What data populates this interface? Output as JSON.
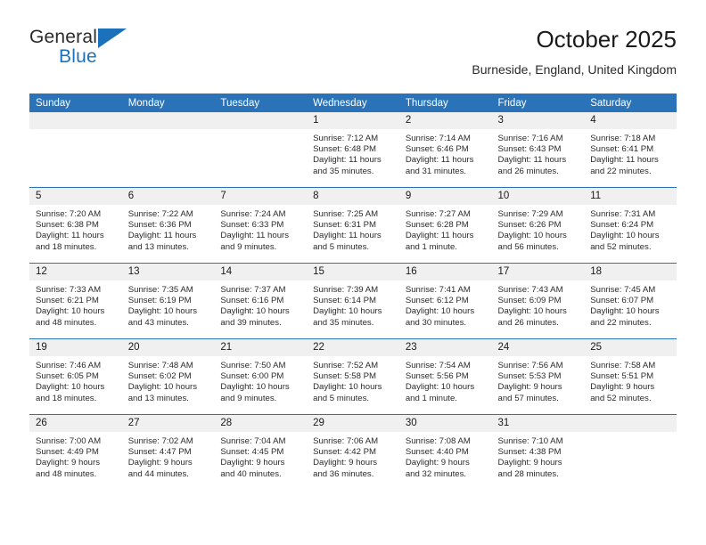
{
  "brand": {
    "name_top": "General",
    "name_bottom": "Blue",
    "accent_color": "#1c71bb"
  },
  "header": {
    "title": "October 2025",
    "subtitle": "Burneside, England, United Kingdom"
  },
  "theme": {
    "header_row_bg": "#2b73b8",
    "day_number_bg": "#f0f0f0",
    "text_color": "#2b2b2b"
  },
  "weekday_headers": [
    "Sunday",
    "Monday",
    "Tuesday",
    "Wednesday",
    "Thursday",
    "Friday",
    "Saturday"
  ],
  "weeks": [
    [
      {
        "day": "",
        "empty": true,
        "sunrise": "",
        "sunset": "",
        "daylight_line1": "",
        "daylight_line2": ""
      },
      {
        "day": "",
        "empty": true,
        "sunrise": "",
        "sunset": "",
        "daylight_line1": "",
        "daylight_line2": ""
      },
      {
        "day": "",
        "empty": true,
        "sunrise": "",
        "sunset": "",
        "daylight_line1": "",
        "daylight_line2": ""
      },
      {
        "day": "1",
        "sunrise": "Sunrise: 7:12 AM",
        "sunset": "Sunset: 6:48 PM",
        "daylight_line1": "Daylight: 11 hours",
        "daylight_line2": "and 35 minutes."
      },
      {
        "day": "2",
        "sunrise": "Sunrise: 7:14 AM",
        "sunset": "Sunset: 6:46 PM",
        "daylight_line1": "Daylight: 11 hours",
        "daylight_line2": "and 31 minutes."
      },
      {
        "day": "3",
        "sunrise": "Sunrise: 7:16 AM",
        "sunset": "Sunset: 6:43 PM",
        "daylight_line1": "Daylight: 11 hours",
        "daylight_line2": "and 26 minutes."
      },
      {
        "day": "4",
        "sunrise": "Sunrise: 7:18 AM",
        "sunset": "Sunset: 6:41 PM",
        "daylight_line1": "Daylight: 11 hours",
        "daylight_line2": "and 22 minutes."
      }
    ],
    [
      {
        "day": "5",
        "sunrise": "Sunrise: 7:20 AM",
        "sunset": "Sunset: 6:38 PM",
        "daylight_line1": "Daylight: 11 hours",
        "daylight_line2": "and 18 minutes."
      },
      {
        "day": "6",
        "sunrise": "Sunrise: 7:22 AM",
        "sunset": "Sunset: 6:36 PM",
        "daylight_line1": "Daylight: 11 hours",
        "daylight_line2": "and 13 minutes."
      },
      {
        "day": "7",
        "sunrise": "Sunrise: 7:24 AM",
        "sunset": "Sunset: 6:33 PM",
        "daylight_line1": "Daylight: 11 hours",
        "daylight_line2": "and 9 minutes."
      },
      {
        "day": "8",
        "sunrise": "Sunrise: 7:25 AM",
        "sunset": "Sunset: 6:31 PM",
        "daylight_line1": "Daylight: 11 hours",
        "daylight_line2": "and 5 minutes."
      },
      {
        "day": "9",
        "sunrise": "Sunrise: 7:27 AM",
        "sunset": "Sunset: 6:28 PM",
        "daylight_line1": "Daylight: 11 hours",
        "daylight_line2": "and 1 minute."
      },
      {
        "day": "10",
        "sunrise": "Sunrise: 7:29 AM",
        "sunset": "Sunset: 6:26 PM",
        "daylight_line1": "Daylight: 10 hours",
        "daylight_line2": "and 56 minutes."
      },
      {
        "day": "11",
        "sunrise": "Sunrise: 7:31 AM",
        "sunset": "Sunset: 6:24 PM",
        "daylight_line1": "Daylight: 10 hours",
        "daylight_line2": "and 52 minutes."
      }
    ],
    [
      {
        "day": "12",
        "sunrise": "Sunrise: 7:33 AM",
        "sunset": "Sunset: 6:21 PM",
        "daylight_line1": "Daylight: 10 hours",
        "daylight_line2": "and 48 minutes."
      },
      {
        "day": "13",
        "sunrise": "Sunrise: 7:35 AM",
        "sunset": "Sunset: 6:19 PM",
        "daylight_line1": "Daylight: 10 hours",
        "daylight_line2": "and 43 minutes."
      },
      {
        "day": "14",
        "sunrise": "Sunrise: 7:37 AM",
        "sunset": "Sunset: 6:16 PM",
        "daylight_line1": "Daylight: 10 hours",
        "daylight_line2": "and 39 minutes."
      },
      {
        "day": "15",
        "sunrise": "Sunrise: 7:39 AM",
        "sunset": "Sunset: 6:14 PM",
        "daylight_line1": "Daylight: 10 hours",
        "daylight_line2": "and 35 minutes."
      },
      {
        "day": "16",
        "sunrise": "Sunrise: 7:41 AM",
        "sunset": "Sunset: 6:12 PM",
        "daylight_line1": "Daylight: 10 hours",
        "daylight_line2": "and 30 minutes."
      },
      {
        "day": "17",
        "sunrise": "Sunrise: 7:43 AM",
        "sunset": "Sunset: 6:09 PM",
        "daylight_line1": "Daylight: 10 hours",
        "daylight_line2": "and 26 minutes."
      },
      {
        "day": "18",
        "sunrise": "Sunrise: 7:45 AM",
        "sunset": "Sunset: 6:07 PM",
        "daylight_line1": "Daylight: 10 hours",
        "daylight_line2": "and 22 minutes."
      }
    ],
    [
      {
        "day": "19",
        "sunrise": "Sunrise: 7:46 AM",
        "sunset": "Sunset: 6:05 PM",
        "daylight_line1": "Daylight: 10 hours",
        "daylight_line2": "and 18 minutes."
      },
      {
        "day": "20",
        "sunrise": "Sunrise: 7:48 AM",
        "sunset": "Sunset: 6:02 PM",
        "daylight_line1": "Daylight: 10 hours",
        "daylight_line2": "and 13 minutes."
      },
      {
        "day": "21",
        "sunrise": "Sunrise: 7:50 AM",
        "sunset": "Sunset: 6:00 PM",
        "daylight_line1": "Daylight: 10 hours",
        "daylight_line2": "and 9 minutes."
      },
      {
        "day": "22",
        "sunrise": "Sunrise: 7:52 AM",
        "sunset": "Sunset: 5:58 PM",
        "daylight_line1": "Daylight: 10 hours",
        "daylight_line2": "and 5 minutes."
      },
      {
        "day": "23",
        "sunrise": "Sunrise: 7:54 AM",
        "sunset": "Sunset: 5:56 PM",
        "daylight_line1": "Daylight: 10 hours",
        "daylight_line2": "and 1 minute."
      },
      {
        "day": "24",
        "sunrise": "Sunrise: 7:56 AM",
        "sunset": "Sunset: 5:53 PM",
        "daylight_line1": "Daylight: 9 hours",
        "daylight_line2": "and 57 minutes."
      },
      {
        "day": "25",
        "sunrise": "Sunrise: 7:58 AM",
        "sunset": "Sunset: 5:51 PM",
        "daylight_line1": "Daylight: 9 hours",
        "daylight_line2": "and 52 minutes."
      }
    ],
    [
      {
        "day": "26",
        "sunrise": "Sunrise: 7:00 AM",
        "sunset": "Sunset: 4:49 PM",
        "daylight_line1": "Daylight: 9 hours",
        "daylight_line2": "and 48 minutes."
      },
      {
        "day": "27",
        "sunrise": "Sunrise: 7:02 AM",
        "sunset": "Sunset: 4:47 PM",
        "daylight_line1": "Daylight: 9 hours",
        "daylight_line2": "and 44 minutes."
      },
      {
        "day": "28",
        "sunrise": "Sunrise: 7:04 AM",
        "sunset": "Sunset: 4:45 PM",
        "daylight_line1": "Daylight: 9 hours",
        "daylight_line2": "and 40 minutes."
      },
      {
        "day": "29",
        "sunrise": "Sunrise: 7:06 AM",
        "sunset": "Sunset: 4:42 PM",
        "daylight_line1": "Daylight: 9 hours",
        "daylight_line2": "and 36 minutes."
      },
      {
        "day": "30",
        "sunrise": "Sunrise: 7:08 AM",
        "sunset": "Sunset: 4:40 PM",
        "daylight_line1": "Daylight: 9 hours",
        "daylight_line2": "and 32 minutes."
      },
      {
        "day": "31",
        "sunrise": "Sunrise: 7:10 AM",
        "sunset": "Sunset: 4:38 PM",
        "daylight_line1": "Daylight: 9 hours",
        "daylight_line2": "and 28 minutes."
      },
      {
        "day": "",
        "empty": true,
        "sunrise": "",
        "sunset": "",
        "daylight_line1": "",
        "daylight_line2": ""
      }
    ]
  ]
}
